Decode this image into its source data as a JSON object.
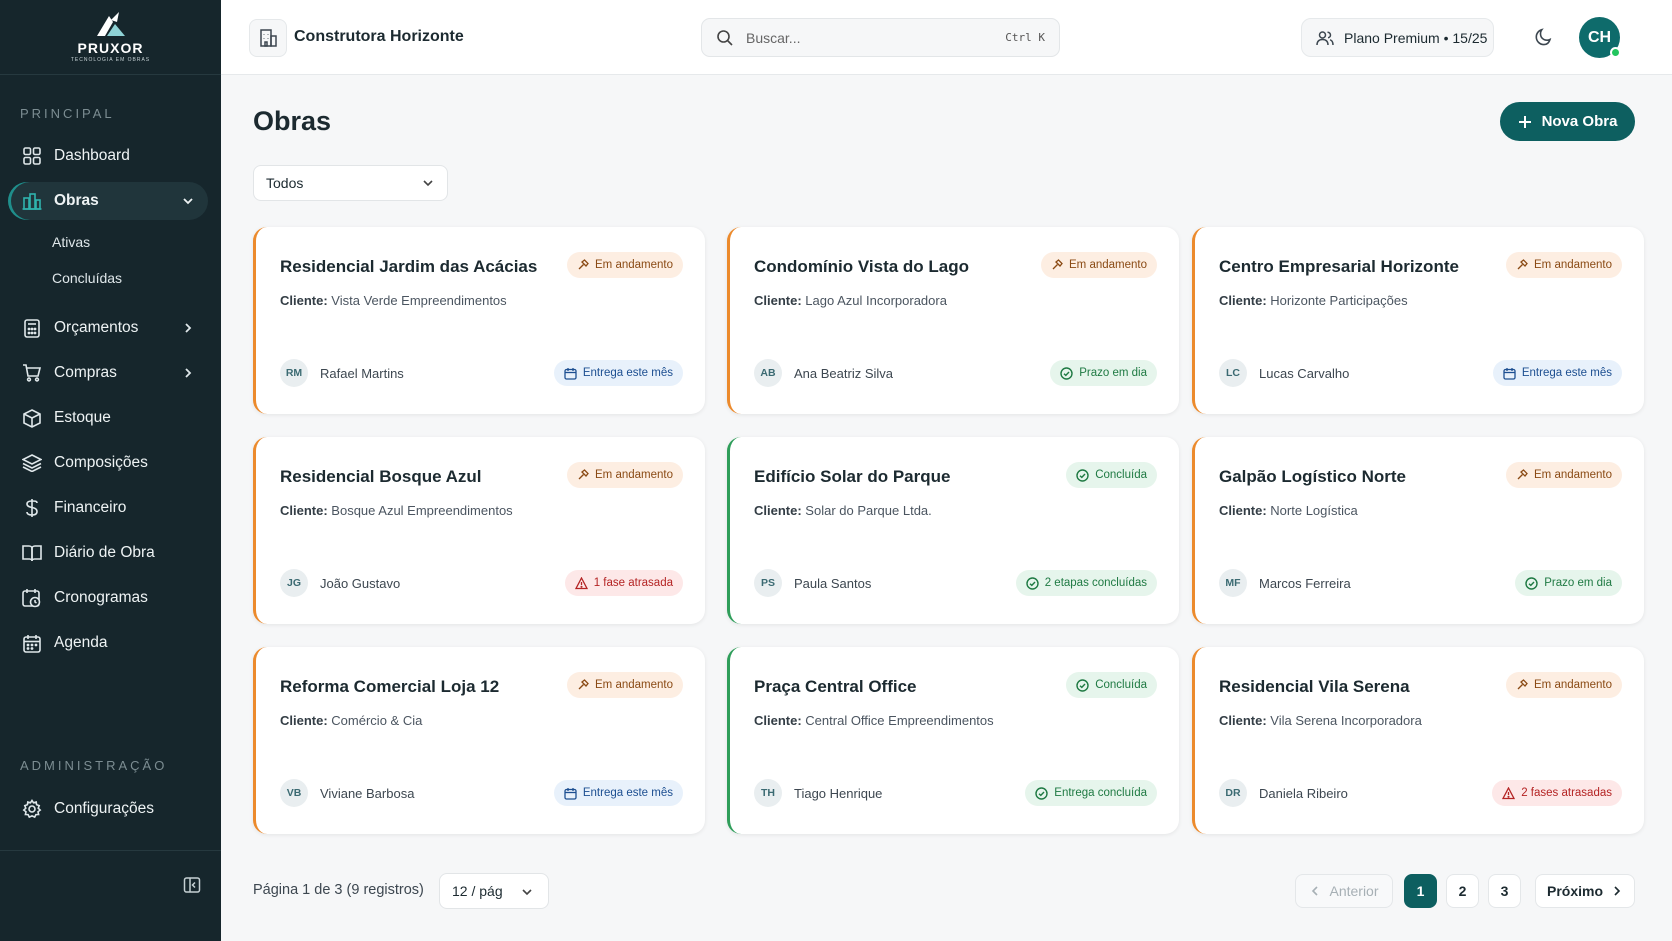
{
  "brand": {
    "name": "PRUXOR",
    "tagline": "TECNOLOGIA EM OBRAS"
  },
  "sidebar": {
    "section_principal": "PRINCIPAL",
    "section_admin": "ADMINISTRAÇÃO",
    "items": [
      {
        "label": "Dashboard",
        "icon": "grid-icon"
      },
      {
        "label": "Obras",
        "icon": "building-icon",
        "active": true,
        "expanded": true
      },
      {
        "label": "Orçamentos",
        "icon": "calculator-icon"
      },
      {
        "label": "Compras",
        "icon": "cart-icon"
      },
      {
        "label": "Estoque",
        "icon": "box-icon"
      },
      {
        "label": "Composições",
        "icon": "layers-icon"
      },
      {
        "label": "Financeiro",
        "icon": "dollar-icon"
      },
      {
        "label": "Diário de Obra",
        "icon": "book-icon"
      },
      {
        "label": "Cronogramas",
        "icon": "calendar-clock-icon"
      },
      {
        "label": "Agenda",
        "icon": "calendar-icon"
      }
    ],
    "obras_sub": [
      "Ativas",
      "Concluídas"
    ],
    "admin_items": [
      {
        "label": "Configurações",
        "icon": "gear-icon"
      }
    ]
  },
  "topbar": {
    "company": "Construtora Horizonte",
    "search_placeholder": "Buscar...",
    "search_shortcut": "Ctrl K",
    "plan": "Plano Premium • 15/25",
    "avatar_initials": "CH"
  },
  "main": {
    "title": "Obras",
    "new_button": "Nova Obra",
    "filter_value": "Todos",
    "client_label": "Cliente:"
  },
  "colors": {
    "accent": "#0d5f60",
    "in_progress": "#ec8a2c",
    "done": "#2f9e5a"
  },
  "cards": [
    {
      "title": "Residencial Jardim das Acácias",
      "client": "Vista Verde Empreendimentos",
      "status": "Em andamento",
      "initials": "RM",
      "person": "Rafael Martins",
      "tag": "Entrega este mês",
      "tag_type": "blue"
    },
    {
      "title": "Condomínio Vista do Lago",
      "client": "Lago Azul Incorporadora",
      "status": "Em andamento",
      "initials": "AB",
      "person": "Ana Beatriz Silva",
      "tag": "Prazo em dia",
      "tag_type": "green"
    },
    {
      "title": "Centro Empresarial Horizonte",
      "client": "Horizonte Participações",
      "status": "Em andamento",
      "initials": "LC",
      "person": "Lucas Carvalho",
      "tag": "Entrega este mês",
      "tag_type": "blue"
    },
    {
      "title": "Residencial Bosque Azul",
      "client": "Bosque Azul Empreendimentos",
      "status": "Em andamento",
      "initials": "JG",
      "person": "João Gustavo",
      "tag": "1 fase atrasada",
      "tag_type": "red"
    },
    {
      "title": "Edifício Solar do Parque",
      "client": "Solar do Parque Ltda.",
      "status": "Concluída",
      "initials": "PS",
      "person": "Paula Santos",
      "tag": "2 etapas concluídas",
      "tag_type": "green"
    },
    {
      "title": "Galpão Logístico Norte",
      "client": "Norte Logística",
      "status": "Em andamento",
      "initials": "MF",
      "person": "Marcos Ferreira",
      "tag": "Prazo em dia",
      "tag_type": "green"
    },
    {
      "title": "Reforma Comercial Loja 12",
      "client": "Comércio & Cia",
      "status": "Em andamento",
      "initials": "VB",
      "person": "Viviane Barbosa",
      "tag": "Entrega este mês",
      "tag_type": "blue"
    },
    {
      "title": "Praça Central Office",
      "client": "Central Office Empreendimentos",
      "status": "Concluída",
      "initials": "TH",
      "person": "Tiago Henrique",
      "tag": "Entrega concluída",
      "tag_type": "green"
    },
    {
      "title": "Residencial Vila Serena",
      "client": "Vila Serena Incorporadora",
      "status": "Em andamento",
      "initials": "DR",
      "person": "Daniela Ribeiro",
      "tag": "2 fases atrasadas",
      "tag_type": "red"
    }
  ],
  "pagination": {
    "info": "Página 1 de 3 (9 registros)",
    "per_page": "12 / pág",
    "prev": "Anterior",
    "next": "Próximo",
    "pages": [
      "1",
      "2",
      "3"
    ],
    "current": "1"
  }
}
